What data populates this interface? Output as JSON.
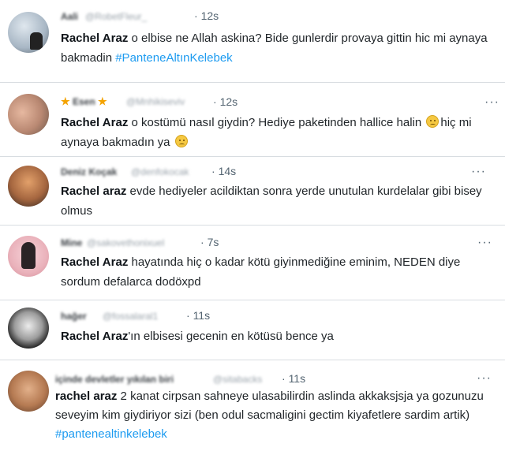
{
  "tweets": [
    {
      "name": "Aali",
      "handle": "@RobetFleur_",
      "time": "12s",
      "author": "Rachel Araz",
      "text": " o elbise ne Allah askina? Bide gunlerdir provaya gittin hic mi aynaya bakmadin ",
      "hashtag": "#PanteneAltınKelebek",
      "avatar_colors": [
        "#b9c7d4",
        "#4b5560"
      ]
    },
    {
      "name": "Esen",
      "handle": "@Mnhikiseviv",
      "time": "12s",
      "author": "Rachel Araz",
      "text_a": " o kostümü nasıl giydin? Hediye paketinden hallice halin ",
      "text_b": "hiç mi aynaya bakmadın ya ",
      "avatar_colors": [
        "#c8a28a",
        "#6e5648"
      ]
    },
    {
      "name": "Deniz Koçak",
      "handle": "@denfokocak",
      "time": "14s",
      "author": "Rachel araz",
      "text": " evde hediyeler acildiktan sonra yerde unutulan kurdelalar gibi bisey olmus",
      "avatar_colors": [
        "#d48a55",
        "#3a2a22"
      ]
    },
    {
      "name": "Mine",
      "handle": "@sakovethonixuel",
      "time": "7s",
      "author": "Rachel Araz",
      "text": " hayatında hiç o kadar kötü giyinmediğine eminim, NEDEN diye sordum defalarca dodöxpd",
      "avatar_colors": [
        "#f2c5cc",
        "#2b2326"
      ]
    },
    {
      "name": "hağer",
      "handle": "@fossalaral1",
      "time": "11s",
      "author": "Rachel Araz",
      "text": "'ın elbisesi gecenin en kötüsü bence ya",
      "avatar_colors": [
        "#d9d9d9",
        "#2a2a2a"
      ]
    },
    {
      "name": "içinde devletler yıkılan biri",
      "handle": "@sitabacks",
      "time": "11s",
      "author": "rachel araz",
      "text": " 2 kanat cirpsan sahneye ulasabilirdin aslinda akkaksjsja ya gozunuzu seveyim kim giydiriyor sizi (ben odul sacmaligini gectim kiyafetlere sardim artik) ",
      "hashtag": "#pantenealtinkelebek",
      "avatar_colors": [
        "#c9926a",
        "#5a3a28"
      ]
    }
  ],
  "menu_icon": "more-dots-icon",
  "accent_color": "#1d9bf0"
}
